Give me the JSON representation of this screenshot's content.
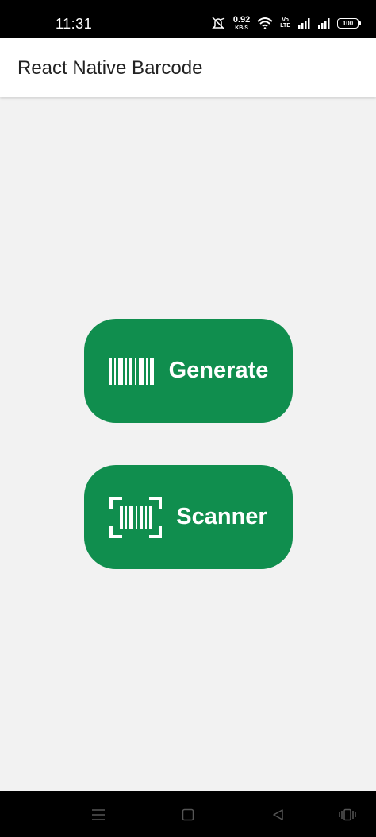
{
  "status_bar": {
    "time": "11:31",
    "net_speed_value": "0.92",
    "net_speed_unit": "KB/S",
    "volte_top": "Vo",
    "volte_bottom": "LTE",
    "battery": "100",
    "icons": [
      "mute-icon",
      "wifi-icon",
      "signal-icon",
      "signal-icon",
      "battery-icon"
    ]
  },
  "header": {
    "title": "React Native Barcode"
  },
  "main": {
    "generate_label": "Generate",
    "scanner_label": "Scanner",
    "button_color": "#108e4e",
    "background_color": "#f2f2f2"
  },
  "nav_bar": {
    "icons": [
      "menu-icon",
      "home-icon",
      "back-icon",
      "recents-icon"
    ]
  }
}
